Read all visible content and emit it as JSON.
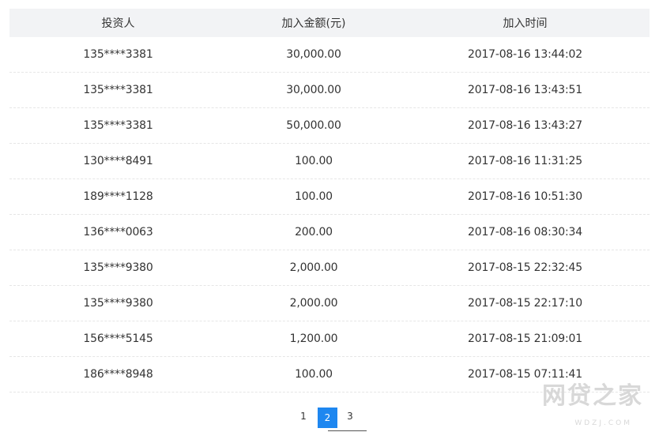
{
  "table": {
    "headers": [
      "投资人",
      "加入金额(元)",
      "加入时间"
    ],
    "rows": [
      [
        "135****3381",
        "30,000.00",
        "2017-08-16 13:44:02"
      ],
      [
        "135****3381",
        "30,000.00",
        "2017-08-16 13:43:51"
      ],
      [
        "135****3381",
        "50,000.00",
        "2017-08-16 13:43:27"
      ],
      [
        "130****8491",
        "100.00",
        "2017-08-16 11:31:25"
      ],
      [
        "189****1128",
        "100.00",
        "2017-08-16 10:51:30"
      ],
      [
        "136****0063",
        "200.00",
        "2017-08-16 08:30:34"
      ],
      [
        "135****9380",
        "2,000.00",
        "2017-08-15 22:32:45"
      ],
      [
        "135****9380",
        "2,000.00",
        "2017-08-15 22:17:10"
      ],
      [
        "156****5145",
        "1,200.00",
        "2017-08-15 21:09:01"
      ],
      [
        "186****8948",
        "100.00",
        "2017-08-15 07:11:41"
      ]
    ]
  },
  "pagination": {
    "pages": [
      "1",
      "2",
      "3"
    ],
    "current": "2"
  },
  "watermark": {
    "text": "网贷之家",
    "sub": "WDZJ.COM"
  },
  "colors": {
    "header_bg": "#f2f3f5",
    "active_page": "#1e87f0",
    "row_divider": "#e6e6e6"
  }
}
